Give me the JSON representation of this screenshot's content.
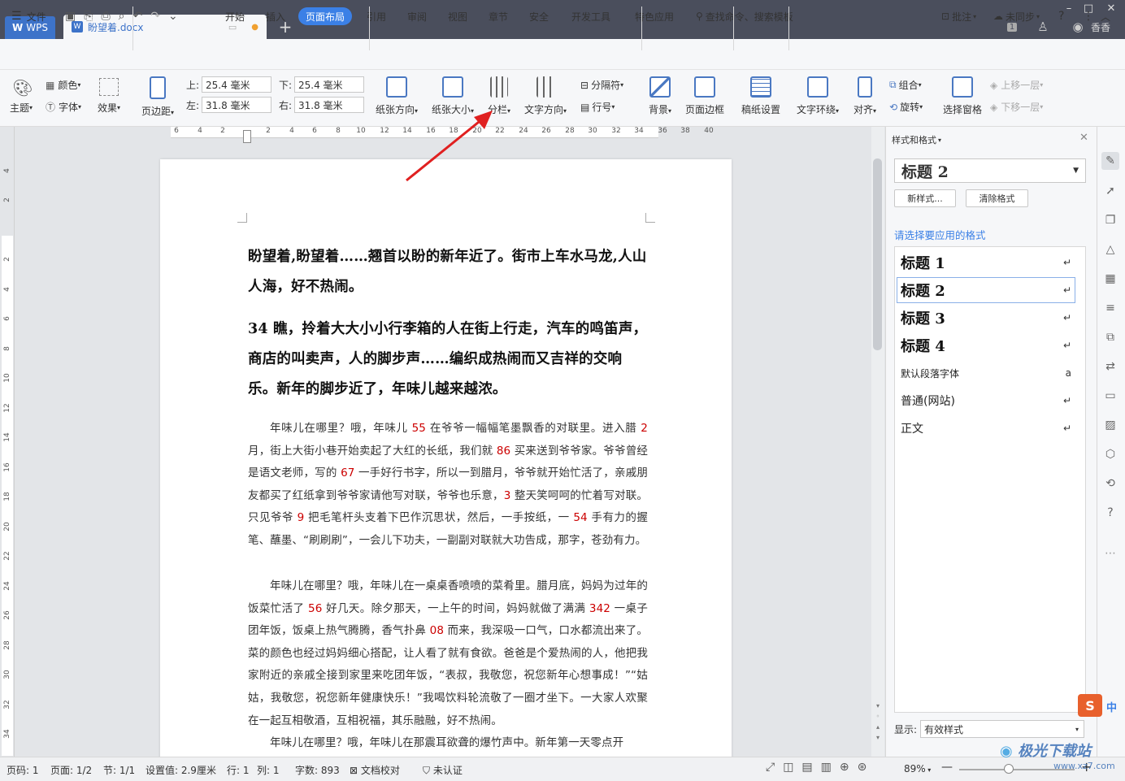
{
  "titlebar": {
    "wps_label": "WPS",
    "doc_tab": "盼望着.docx",
    "new_tab": "+",
    "user_name": "香香",
    "badge": "1"
  },
  "menubar": {
    "file": "文件",
    "tabs": [
      "开始",
      "插入",
      "页面布局",
      "引用",
      "审阅",
      "视图",
      "章节",
      "安全",
      "开发工具",
      "特色应用"
    ],
    "active_tab": "页面布局",
    "search": "查找命令、搜索模板",
    "annotate": "批注",
    "sync": "未同步"
  },
  "ribbon": {
    "color": "颜色",
    "theme": "主题",
    "font": "字体",
    "effect": "效果",
    "margins": "页边距",
    "top_label": "上:",
    "top_val": "25.4 毫米",
    "bottom_label": "下:",
    "bottom_val": "25.4 毫米",
    "left_label": "左:",
    "left_val": "31.8 毫米",
    "right_label": "右:",
    "right_val": "31.8 毫米",
    "orientation": "纸张方向",
    "size": "纸张大小",
    "columns": "分栏",
    "text_dir": "文字方向",
    "separator": "分隔符",
    "line_num": "行号",
    "background": "背景",
    "page_border": "页面边框",
    "manuscript": "稿纸设置",
    "wrap": "文字环绕",
    "align": "对齐",
    "group": "组合",
    "rotate": "旋转",
    "select_pane": "选择窗格",
    "bring_forward": "上移一层",
    "send_backward": "下移一层"
  },
  "ruler": {
    "h_ticks": [
      "6",
      "4",
      "2",
      "2",
      "4",
      "6",
      "8",
      "10",
      "12",
      "14",
      "16",
      "18",
      "20",
      "22",
      "24",
      "26",
      "28",
      "30",
      "32",
      "34",
      "36",
      "38",
      "40"
    ],
    "v_ticks": [
      "4",
      "2",
      "2",
      "4",
      "6",
      "8",
      "10",
      "12",
      "14",
      "16",
      "18",
      "20",
      "22",
      "24",
      "26",
      "28",
      "30",
      "32",
      "34"
    ]
  },
  "document": {
    "heading1": "盼望着,盼望着……翘首以盼的新年近了。街市上车水马龙,人山人海，好不热闹。",
    "heading2": "34 瞧，拎着大大小小行李箱的人在街上行走，汽车的鸣笛声，商店的叫卖声，人的脚步声……编织成热闹而又吉祥的交响乐。新年的脚步近了，年味儿越来越浓。",
    "p1": [
      {
        "t": "年味儿在哪里？哦，年味儿 "
      },
      {
        "t": "55",
        "red": true
      },
      {
        "t": " 在爷爷一幅幅笔墨飘香的对联里。进入腊 "
      },
      {
        "t": "2",
        "red": true
      },
      {
        "t": " 月，街上大街小巷开始卖起了大红的长纸，我们就 "
      },
      {
        "t": "86",
        "red": true
      },
      {
        "t": " 买来送到爷爷家。爷爷曾经是语文老师，写的 "
      },
      {
        "t": "67",
        "red": true
      },
      {
        "t": " 一手好行书字，所以一到腊月，爷爷就开始忙活了，亲戚朋友都买了红纸拿到爷爷家请他写对联，爷爷也乐意，"
      },
      {
        "t": "3",
        "red": true
      },
      {
        "t": " 整天笑呵呵的忙着写对联。只见爷爷 "
      },
      {
        "t": "9",
        "red": true
      },
      {
        "t": " 把毛笔杆头支着下巴作沉思状，然后，一手按纸，一 "
      },
      {
        "t": "54",
        "red": true
      },
      {
        "t": " 手有力的握笔、蘸墨、“刷刷刷”，一会儿下功夫，一副副对联就大功告成，那字，苍劲有力。"
      }
    ],
    "p2": [
      {
        "t": "年味儿在哪里？哦，年味儿在一桌桌香喷喷的菜肴里。腊月底，妈妈为过年的饭菜忙活了 "
      },
      {
        "t": "56",
        "red": true
      },
      {
        "t": " 好几天。除夕那天，一上午的时间，妈妈就做了满满 "
      },
      {
        "t": "342",
        "red": true
      },
      {
        "t": " 一桌子团年饭，饭桌上热气腾腾，香气扑鼻 "
      },
      {
        "t": "08",
        "red": true
      },
      {
        "t": " 而来，我深吸一口气，口水都流出来了。菜的颜色也经过妈妈细心搭配，让人看了就有食欲。爸爸是个爱热闹的人，他把我家附近的亲戚全接到家里来吃团年饭，“表叔，我敬您，祝您新年心想事成！”“姑姑，我敬您，祝您新年健康快乐！”我喝饮料轮流敬了一圈才坐下。一大家人欢聚在一起互相敬酒，互相祝福，其乐融融，好不热闹。"
      }
    ],
    "p3": "年味儿在哪里？哦，年味儿在那震耳欲聋的爆竹声中。新年第一天零点开"
  },
  "panel": {
    "title": "样式和格式",
    "current_style": "标题  2",
    "new_style": "新样式...",
    "clear_format": "清除格式",
    "prompt": "请选择要应用的格式",
    "styles": [
      {
        "name": "标题  1",
        "big": true,
        "mark": "↵"
      },
      {
        "name": "标题  2",
        "big": true,
        "mark": "↵"
      },
      {
        "name": "标题  3",
        "big": true,
        "mark": "↵"
      },
      {
        "name": "标题  4",
        "big": true,
        "mark": "↵"
      },
      {
        "name": "默认段落字体",
        "big": false,
        "mark": "a"
      },
      {
        "name": "普通(网站)",
        "big": false,
        "mark": "↵"
      },
      {
        "name": "正文",
        "big": false,
        "mark": "↵"
      }
    ],
    "show_label": "显示:",
    "show_value": "有效样式"
  },
  "status": {
    "page": "页码: 1",
    "pages": "页面: 1/2",
    "section": "节: 1/1",
    "setting": "设置值: 2.9厘米",
    "row": "行: 1",
    "col": "列: 1",
    "words": "字数: 893",
    "proof": "文档校对",
    "cert": "未认证",
    "zoom": "89%",
    "watermark": "极光下载站",
    "watermark_url": "www.xz7.com"
  },
  "colors": {
    "accent": "#3b80e6",
    "titlebar": "#4a4e5c",
    "arrow": "#e02020",
    "red_text": "#cc0000"
  }
}
